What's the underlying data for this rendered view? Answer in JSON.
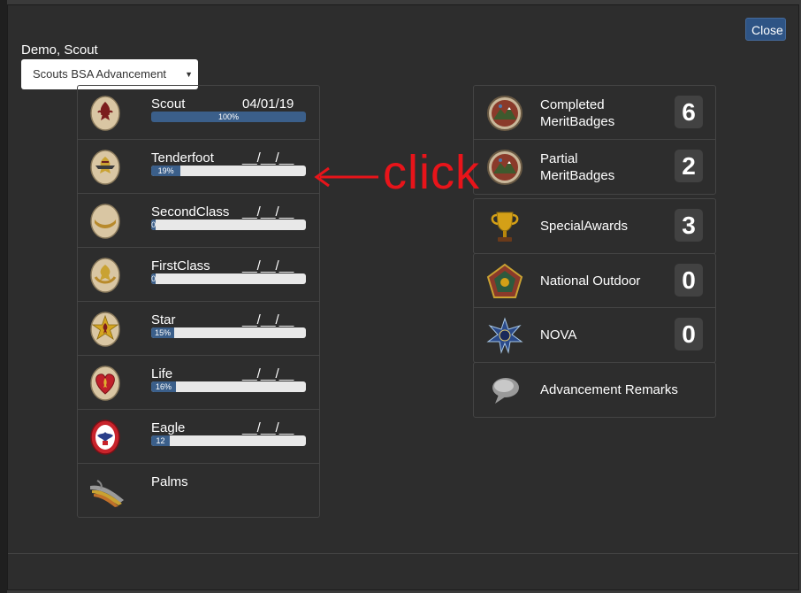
{
  "dialog": {
    "close_label": "Close",
    "scout_name": "Demo, Scout",
    "advancement_select": "Scouts BSA Advancement"
  },
  "ranks": [
    {
      "name": "Scout",
      "date": "04/01/19",
      "progress_pct": 100,
      "bar_label": "100%",
      "icon": "scout-badge-icon"
    },
    {
      "name": "Tenderfoot",
      "date": "__/__/__",
      "progress_pct": 19,
      "bar_label": "19%",
      "icon": "tenderfoot-badge-icon"
    },
    {
      "name": "SecondClass",
      "date": "__/__/__",
      "progress_pct": 0,
      "bar_label": "0",
      "icon": "second-class-badge-icon"
    },
    {
      "name": "FirstClass",
      "date": "__/__/__",
      "progress_pct": 0,
      "bar_label": "0",
      "icon": "first-class-badge-icon"
    },
    {
      "name": "Star",
      "date": "__/__/__",
      "progress_pct": 15,
      "bar_label": "15%",
      "icon": "star-badge-icon"
    },
    {
      "name": "Life",
      "date": "__/__/__",
      "progress_pct": 16,
      "bar_label": "16%",
      "icon": "life-badge-icon"
    },
    {
      "name": "Eagle",
      "date": "__/__/__",
      "progress_pct": 12,
      "bar_label": "12",
      "icon": "eagle-badge-icon"
    },
    {
      "name": "Palms",
      "date": "",
      "progress_pct": null,
      "bar_label": "",
      "icon": "palms-icon"
    }
  ],
  "awards": {
    "completed_mb": {
      "label_line1": "Completed",
      "label_line2": "MeritBadges",
      "count": "6",
      "icon": "merit-badge-icon"
    },
    "partial_mb": {
      "label_line1": "Partial",
      "label_line2": "MeritBadges",
      "count": "2",
      "icon": "merit-badge-icon"
    },
    "special_awards": {
      "label": "SpecialAwards",
      "count": "3",
      "icon": "trophy-icon"
    },
    "national_outdoor": {
      "label": "National Outdoor",
      "count": "0",
      "icon": "national-outdoor-icon"
    },
    "nova": {
      "label": "NOVA",
      "count": "0",
      "icon": "nova-icon"
    },
    "remarks": {
      "label": "Advancement Remarks",
      "icon": "speech-bubble-icon"
    }
  },
  "annotation": {
    "text": "click",
    "color": "#e8141a"
  },
  "colors": {
    "progress_fill": "#3b5f8a",
    "close_button": "#2e5485",
    "modal_bg": "#2d2d2d"
  }
}
